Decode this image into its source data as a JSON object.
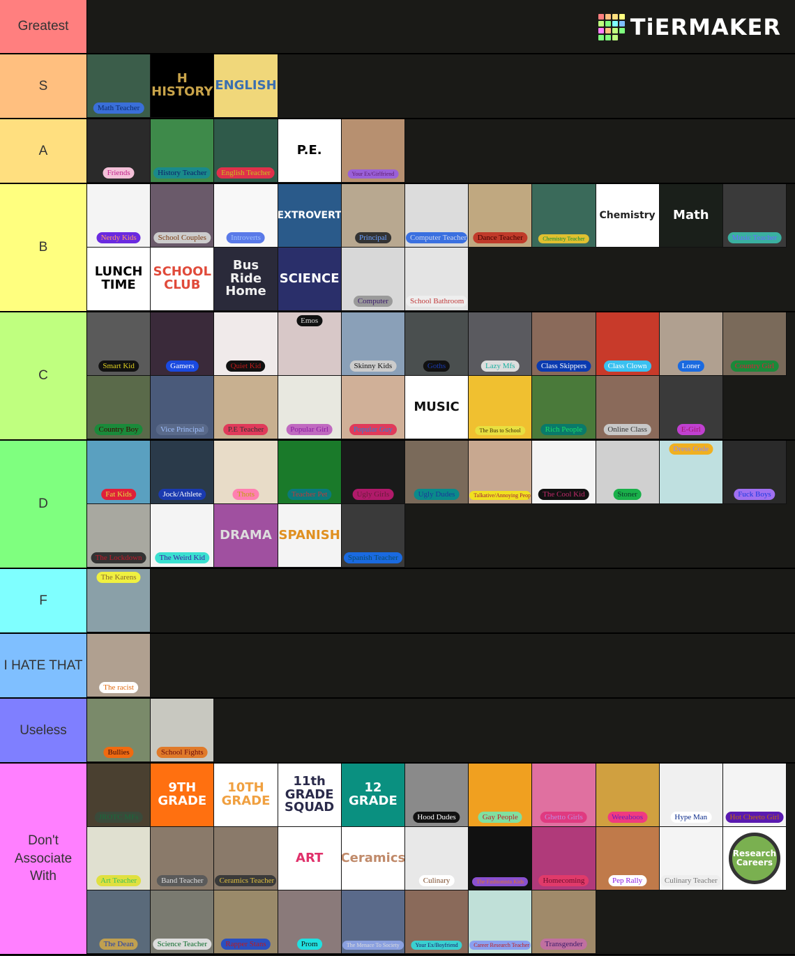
{
  "logo": {
    "text": "TiERMAKER",
    "colors": [
      "#ff7f7f",
      "#ffbf7f",
      "#ffdf7f",
      "#ffff7f",
      "#bfff7f",
      "#7fff7f",
      "#7fffff",
      "#7fbfff",
      "#ff7fff",
      "#ffbf7f",
      "#bfff7f",
      "#7fff7f",
      "#7fff7f",
      "#7fff7f",
      "#bfff7f",
      "#1a1a17"
    ]
  },
  "tiers": [
    {
      "label": "Greatest",
      "color": "#ff7f7f",
      "items": []
    },
    {
      "label": "S",
      "color": "#ffbf7f",
      "items": [
        {
          "caption": "Math Teacher",
          "bg": "#3b5d4a",
          "pill": "#3a6fd8",
          "fg": "#0b2a6a"
        },
        {
          "art": "H\nHISTORY",
          "bg": "#000000",
          "artColor": "#c9a44a"
        },
        {
          "art": "ENGLISH",
          "bg": "#f0d77a",
          "artColor": "#3b6fb0"
        }
      ]
    },
    {
      "label": "A",
      "color": "#ffdf7f",
      "items": [
        {
          "caption": "Friends",
          "bg": "#2a2a2a",
          "pill": "#f3c0d8",
          "fg": "#c0208a"
        },
        {
          "caption": "History Teacher",
          "bg": "#3e8a4a",
          "pill": "#1a8a8a",
          "fg": "#0b1e6a"
        },
        {
          "caption": "English Teacher",
          "bg": "#2f5a4a",
          "pill": "#e0304a",
          "fg": "#c8c020"
        },
        {
          "art": "P.E.",
          "bg": "#ffffff",
          "artColor": "#000000"
        },
        {
          "caption": "Your Ex/Girlfriend",
          "bg": "#b79070",
          "pill": "#9a60d8",
          "fg": "#5a1a6a"
        }
      ]
    },
    {
      "label": "B",
      "color": "#ffff7f",
      "items": [
        {
          "caption": "Nerdy Kids",
          "bg": "#f4f4f4",
          "pill": "#6a2ae0",
          "fg": "#ff9a6a"
        },
        {
          "caption": "School Couples",
          "bg": "#6a5a6a",
          "pill": "#cccccc",
          "fg": "#7a3a10"
        },
        {
          "caption": "Introverts",
          "bg": "#f8f8f8",
          "pill": "#5a7ae8",
          "fg": "#a0c0ff"
        },
        {
          "art": "EXTROVERT",
          "bg": "#2a5a8a",
          "artColor": "#ffffff"
        },
        {
          "caption": "Principal",
          "bg": "#b8a890",
          "pill": "#333333",
          "fg": "#6aa0ff"
        },
        {
          "caption": "Computer Teacher",
          "bg": "#dcdcdc",
          "pill": "#3a70e0",
          "fg": "#cfd8f0"
        },
        {
          "caption": "Dance Teacher",
          "bg": "#c0a880",
          "pill": "#c03a2a",
          "fg": "#400000"
        },
        {
          "caption": "Chemistry Teacher",
          "bg": "#3a6a5a",
          "pill": "#e0c030",
          "fg": "#0a8a3a"
        },
        {
          "art": "Chemistry",
          "bg": "#ffffff",
          "artColor": "#222222"
        },
        {
          "art": "Math",
          "bg": "#1a1f1a",
          "artColor": "#ffffff"
        },
        {
          "caption": "Music Teacher",
          "bg": "#3a3a3a",
          "pill": "#3ab0a0",
          "fg": "#6a6aff"
        },
        {
          "art": "LUNCH\nTIME",
          "bg": "#ffffff",
          "artColor": "#000000"
        },
        {
          "art": "SCHOOL\nCLUB",
          "bg": "#ffffff",
          "artColor": "#e04a3a"
        },
        {
          "art": "Bus Ride\nHome",
          "bg": "#2a2a3a",
          "artColor": "#f0f0f0"
        },
        {
          "art": "SCIENCE",
          "bg": "#2a2f6a",
          "artColor": "#ffffff"
        },
        {
          "caption": "Computer",
          "bg": "#d8d8d8",
          "pill": "#9a9a9a",
          "fg": "#3a1a6a"
        },
        {
          "caption": "School Bathroom",
          "bg": "#e4e4e4",
          "pill": "#eeeeee",
          "fg": "#c03a3a"
        }
      ]
    },
    {
      "label": "C",
      "color": "#bfff7f",
      "items": [
        {
          "caption": "Smart Kid",
          "bg": "#5a5a5a",
          "pill": "#111111",
          "fg": "#e0d020"
        },
        {
          "caption": "Gamers",
          "bg": "#3a2a3a",
          "pill": "#1a4ae0",
          "fg": "#ffffff"
        },
        {
          "caption": "Quiet Kid",
          "bg": "#f0eaea",
          "pill": "#111111",
          "fg": "#c01a1a"
        },
        {
          "caption": "Emos",
          "bg": "#d8c8c8",
          "pill": "#111111",
          "fg": "#dddddd",
          "top": true
        },
        {
          "caption": "Skinny Kids",
          "bg": "#8aa0b8",
          "pill": "#cccccc",
          "fg": "#111111"
        },
        {
          "caption": "Goths",
          "bg": "#4a4f4f",
          "pill": "#111111",
          "fg": "#1a3ab0"
        },
        {
          "caption": "Lazy Mfs",
          "bg": "#5a5a5f",
          "pill": "#dddddd",
          "fg": "#1ab0a0"
        },
        {
          "caption": "Class Skippers",
          "bg": "#8a6a5a",
          "pill": "#0a3ab0",
          "fg": "#ffffff"
        },
        {
          "caption": "Class Clown",
          "bg": "#c83a2a",
          "pill": "#3ac0f0",
          "fg": "#ffffff"
        },
        {
          "caption": "Loner",
          "bg": "#b0a090",
          "pill": "#1a6ae0",
          "fg": "#ffffff"
        },
        {
          "caption": "Country Girl",
          "bg": "#7a6a5a",
          "pill": "#1a8a3a",
          "fg": "#e01a3a"
        },
        {
          "caption": "Country Boy",
          "bg": "#5a6a4a",
          "pill": "#1a8a3a",
          "fg": "#400000"
        },
        {
          "caption": "Vice Principal",
          "bg": "#4a5a7a",
          "pill": "#5a6a8a",
          "fg": "#a0c0ff"
        },
        {
          "caption": "P.E Teacher",
          "bg": "#c8b090",
          "pill": "#e03a5a",
          "fg": "#333333"
        },
        {
          "caption": "Popular Girl",
          "bg": "#e8e8e0",
          "pill": "#c06ac0",
          "fg": "#8a1aa0"
        },
        {
          "caption": "Popular Guy",
          "bg": "#d0b098",
          "pill": "#e03a5a",
          "fg": "#1a8ae0"
        },
        {
          "art": "MUSIC",
          "bg": "#ffffff",
          "artColor": "#111111"
        },
        {
          "caption": "The Bus to School",
          "bg": "#f0c030",
          "pill": "#e8e040",
          "fg": "#3a2a00"
        },
        {
          "caption": "Rich People",
          "bg": "#4a7a3a",
          "pill": "#0a7a6a",
          "fg": "#1ae06a"
        },
        {
          "caption": "Online Class",
          "bg": "#8a6a5a",
          "pill": "#c8c8c8",
          "fg": "#333333"
        },
        {
          "caption": "E-Girl",
          "bg": "#3a3a3a",
          "pill": "#c040d0",
          "fg": "#a01a6a"
        }
      ]
    },
    {
      "label": "D",
      "color": "#7fff7f",
      "items": [
        {
          "caption": "Fat Kids",
          "bg": "#5aa0c0",
          "pill": "#e0203a",
          "fg": "#e0e040"
        },
        {
          "caption": "Jock/Athlete",
          "bg": "#2a3a4a",
          "pill": "#1a3ab0",
          "fg": "#ffffff"
        },
        {
          "caption": "Thots",
          "bg": "#e8dcc8",
          "pill": "#ff80b0",
          "fg": "#c0a010"
        },
        {
          "caption": "Teacher Pet",
          "bg": "#1a7a2a",
          "pill": "#0a7a7a",
          "fg": "#c03a3a"
        },
        {
          "caption": "Ugly Girls",
          "bg": "#1a1a1a",
          "pill": "#b01a6a",
          "fg": "#6a1a3a"
        },
        {
          "caption": "Ugly Dudes",
          "bg": "#7a6a5a",
          "pill": "#0a8a8a",
          "fg": "#1a3a9a"
        },
        {
          "caption": "Talkative/Annoying People",
          "bg": "#c8a890",
          "pill": "#f0e020",
          "fg": "#a01a3a"
        },
        {
          "caption": "The Cool Kid",
          "bg": "#f4f4f4",
          "pill": "#111111",
          "fg": "#c02a6a"
        },
        {
          "caption": "Stoner",
          "bg": "#d0d0d0",
          "pill": "#1ab04a",
          "fg": "#0a3a2a"
        },
        {
          "caption": "Dress Code",
          "bg": "#bfe0e0",
          "pill": "#f0b020",
          "fg": "#8a8aff",
          "top": true
        },
        {
          "caption": "Fuck Boys",
          "bg": "#2a2a2a",
          "pill": "#a070f0",
          "fg": "#1a3ae0"
        },
        {
          "caption": "The Lockdown",
          "bg": "#a8a8a0",
          "pill": "#333333",
          "fg": "#c01a2a"
        },
        {
          "caption": "The Weird Kid",
          "bg": "#f4f4f4",
          "pill": "#3ae0d0",
          "fg": "#3a1aa0"
        },
        {
          "art": "DRAMA",
          "bg": "#a050a0",
          "artColor": "#dddddd"
        },
        {
          "art": "SPANISH",
          "bg": "#f4f4f4",
          "artColor": "#e09020"
        },
        {
          "caption": "Spanish Teacher",
          "bg": "#3a3a3a",
          "pill": "#1a6ae0",
          "fg": "#0a4a6a"
        }
      ]
    },
    {
      "label": "F",
      "color": "#7fffff",
      "items": [
        {
          "caption": "The Karens",
          "bg": "#8aa0a8",
          "pill": "#f0f040",
          "fg": "#8a6a2a",
          "top": true
        }
      ]
    },
    {
      "label": "I HATE THAT",
      "color": "#7fbfff",
      "items": [
        {
          "caption": "The racist",
          "bg": "#b0a090",
          "pill": "#ffffff",
          "fg": "#e06a10"
        }
      ]
    },
    {
      "label": "Useless",
      "color": "#7f7fff",
      "items": [
        {
          "caption": "Bullies",
          "bg": "#7a8a6a",
          "pill": "#f06a10",
          "fg": "#3a0a0a"
        },
        {
          "caption": "School Fights",
          "bg": "#c8c8c0",
          "pill": "#e07a2a",
          "fg": "#6a0a0a"
        }
      ]
    },
    {
      "label": "Don't Associate With",
      "color": "#ff7fff",
      "items": [
        {
          "caption": "JROTC MFs",
          "bg": "#4a4030",
          "pill": "#3a4a3a",
          "fg": "#1a6a3a"
        },
        {
          "art": "9TH\nGRADE",
          "bg": "#ff7010",
          "artColor": "#ffffff"
        },
        {
          "art": "10TH\nGRADE",
          "bg": "#ffffff",
          "artColor": "#f0a040"
        },
        {
          "art": "11th\nGRADE\nSQUAD",
          "bg": "#ffffff",
          "artColor": "#2a2a4a"
        },
        {
          "art": "12\nGRADE",
          "bg": "#0a9080",
          "artColor": "#ffffff"
        },
        {
          "caption": "Hood Dudes",
          "bg": "#8a8a8a",
          "pill": "#111111",
          "fg": "#ffffff"
        },
        {
          "caption": "Gay People",
          "bg": "#f0a020",
          "pill": "#80e0a0",
          "fg": "#c0202a"
        },
        {
          "caption": "Ghetto Girls",
          "bg": "#e070a0",
          "pill": "#e03a80",
          "fg": "#c08ae0"
        },
        {
          "caption": "Weeaboos",
          "bg": "#d0a040",
          "pill": "#f03a80",
          "fg": "#6a1ac0"
        },
        {
          "caption": "Hype Man",
          "bg": "#f0f0f0",
          "pill": "#ffffff",
          "fg": "#0a2a8a"
        },
        {
          "caption": "Hot Cheeto Girl",
          "bg": "#f4f4f4",
          "pill": "#5a1ab0",
          "fg": "#c06a10"
        },
        {
          "caption": "Art Teacher",
          "bg": "#e0e0d0",
          "pill": "#e0e040",
          "fg": "#3ac05a"
        },
        {
          "caption": "Band Teacher",
          "bg": "#8a7a6a",
          "pill": "#5a5a5a",
          "fg": "#dddddd"
        },
        {
          "caption": "Ceramics Teacher",
          "bg": "#8a7a6a",
          "pill": "#3a3a3a",
          "fg": "#e0c040"
        },
        {
          "art": "ART",
          "bg": "#ffffff",
          "artColor": "#e0306a"
        },
        {
          "art": "Ceramics",
          "bg": "#ffffff",
          "artColor": "#c08a6a"
        },
        {
          "caption": "Culinary",
          "bg": "#e8e8e8",
          "pill": "#ffffff",
          "fg": "#7a4a2a"
        },
        {
          "caption": "The Fashionista Kids",
          "bg": "#111111",
          "pill": "#8a50d0",
          "fg": "#e07a2a"
        },
        {
          "caption": "Homecoming",
          "bg": "#b03a7a",
          "pill": "#e03a6a",
          "fg": "#6a0a2a"
        },
        {
          "caption": "Pep Rally",
          "bg": "#c07a4a",
          "pill": "#ffffff",
          "fg": "#8a1ae0"
        },
        {
          "caption": "Culinary Teacher",
          "bg": "#f4f4f4",
          "pill": "#eeeeee",
          "fg": "#777777"
        },
        {
          "art": "Research\nCareers",
          "bg": "#ffffff",
          "artColor": "#ffffff",
          "circle": "#7ab050"
        },
        {
          "caption": "The Dean",
          "bg": "#5a6a7a",
          "pill": "#c0a050",
          "fg": "#1a3ab0"
        },
        {
          "caption": "Science Teacher",
          "bg": "#7a7a70",
          "pill": "#dddddd",
          "fg": "#0a6a2a"
        },
        {
          "caption": "Rapper Stans",
          "bg": "#9a8a6a",
          "pill": "#2a50c0",
          "fg": "#c01a1a"
        },
        {
          "caption": "Prom",
          "bg": "#8a7a7a",
          "pill": "#20e0e0",
          "fg": "#111111"
        },
        {
          "caption": "The Menace To Society",
          "bg": "#5a6a8a",
          "pill": "#8aa0e0",
          "fg": "#dddddd"
        },
        {
          "caption": "Your Ex/Boyfriend",
          "bg": "#8a6a5a",
          "pill": "#3ad0d0",
          "fg": "#1a1a6a"
        },
        {
          "caption": "Career Research Teacher",
          "bg": "#c0e0d8",
          "pill": "#8aa0f0",
          "fg": "#c01a1a"
        },
        {
          "caption": "Transgender",
          "bg": "#a08a6a",
          "pill": "#c070a0",
          "fg": "#3a1a6a"
        }
      ]
    }
  ]
}
